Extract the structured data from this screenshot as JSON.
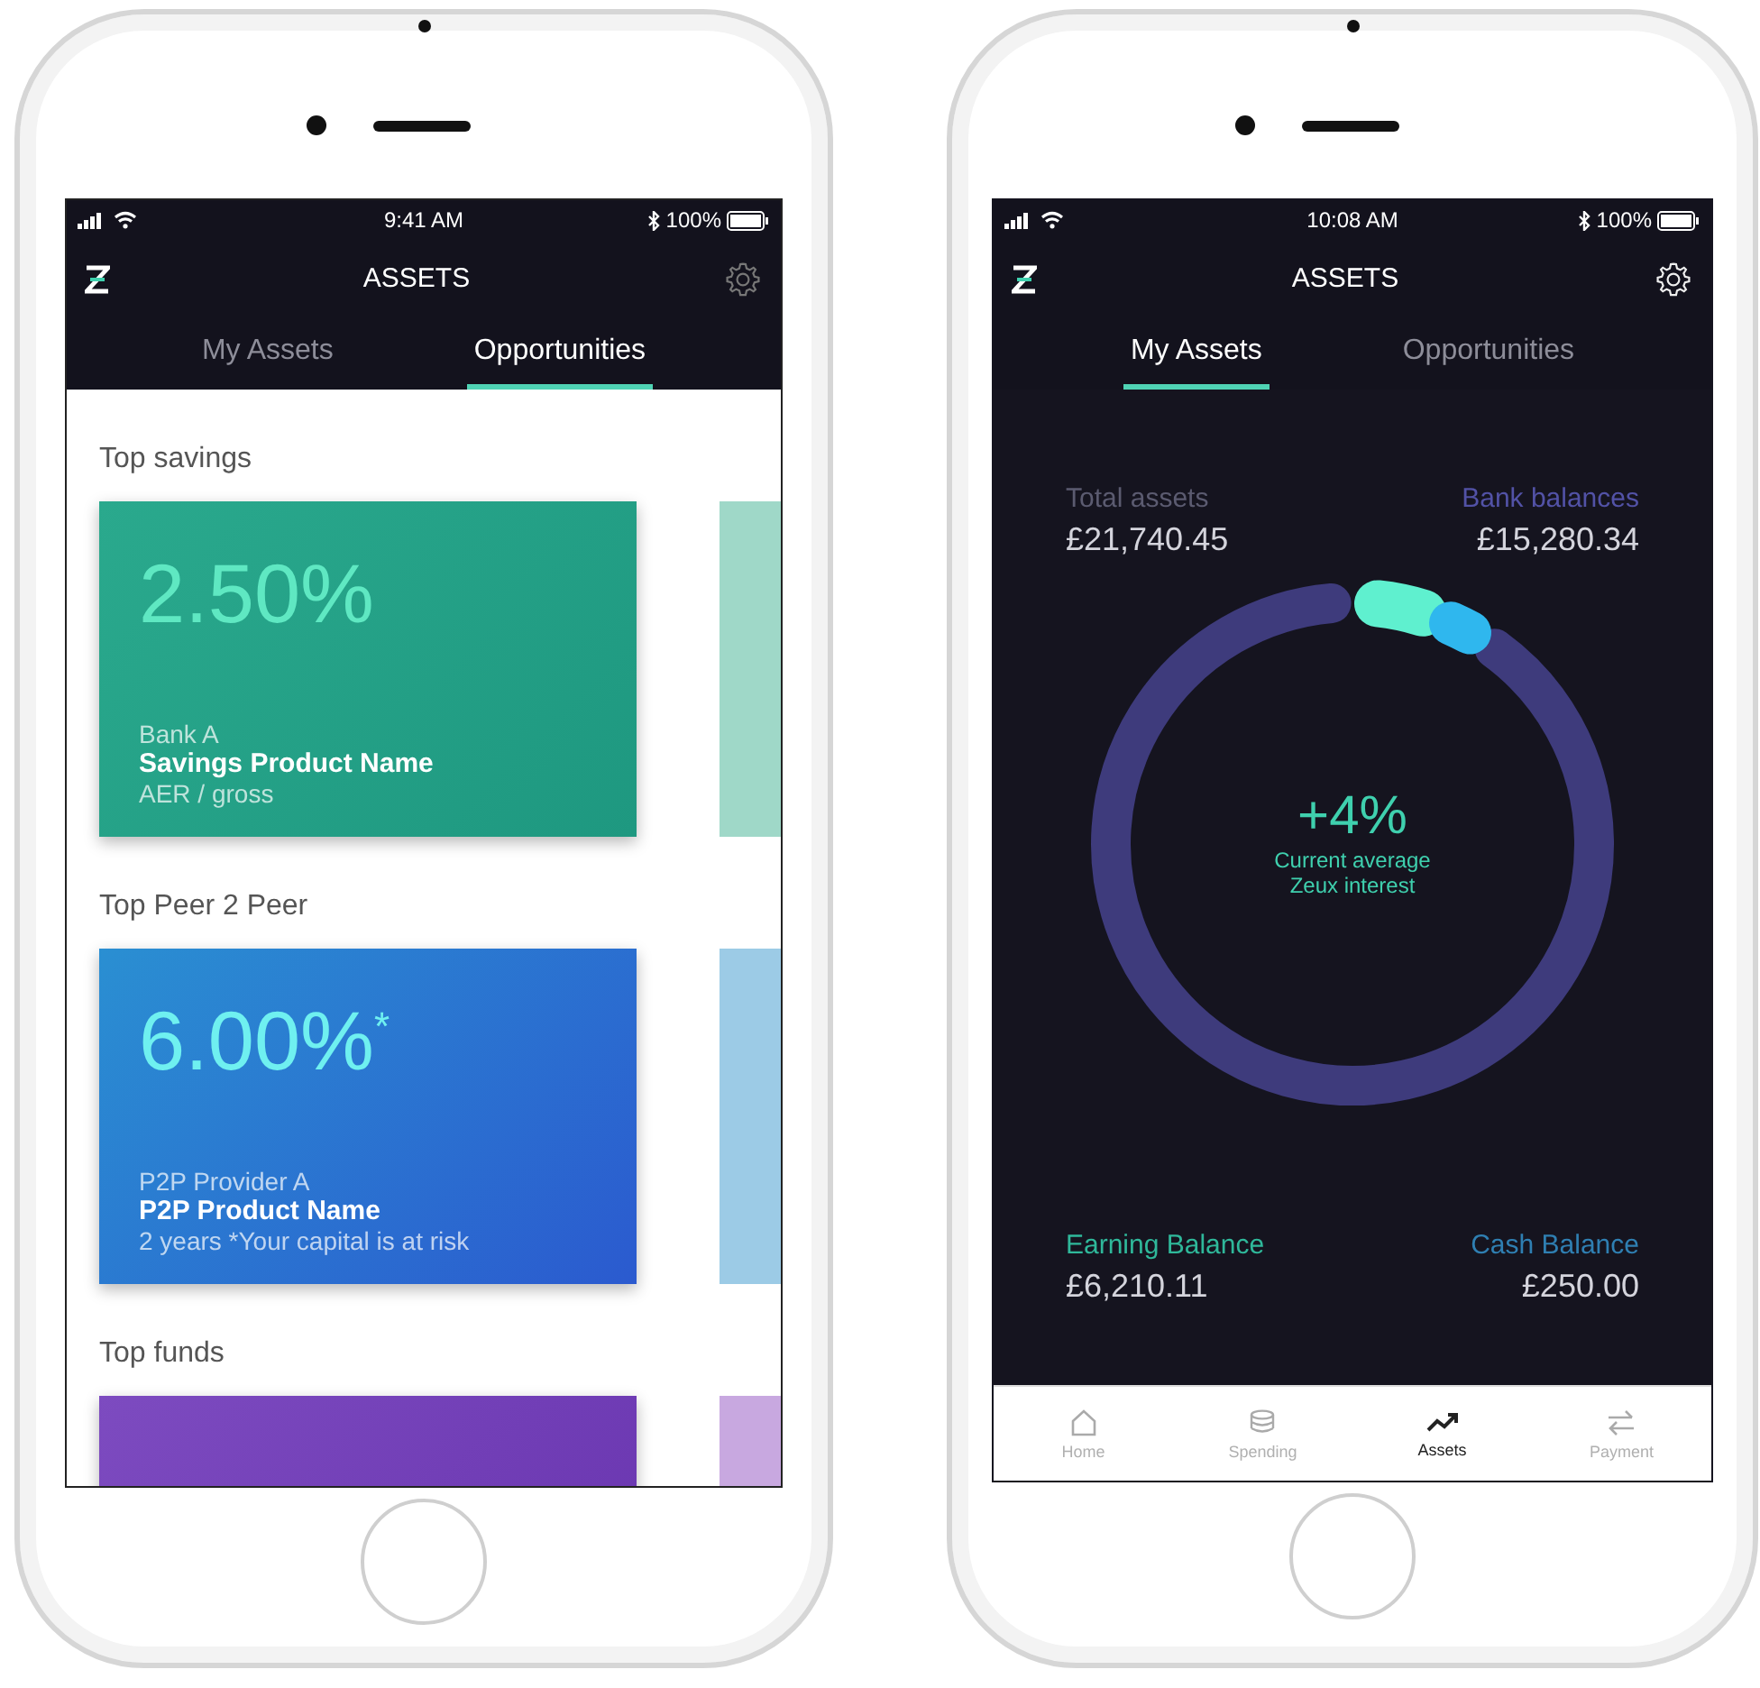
{
  "phones": [
    {
      "kind": "opportunities",
      "status_bar": {
        "time": "9:41 AM",
        "battery": "100%"
      },
      "title": "ASSETS",
      "tabs": [
        {
          "label": "My Assets",
          "selected": false
        },
        {
          "label": "Opportunities",
          "selected": true
        }
      ],
      "sections": [
        {
          "title": "Top savings",
          "kind": "savings",
          "cards": [
            {
              "kind": "full",
              "rate": "2.50%",
              "provider": "Bank A",
              "product": "Savings Product Name",
              "note": "AER / gross"
            },
            {
              "kind": "peek"
            }
          ]
        },
        {
          "title": "Top Peer 2 Peer",
          "kind": "p2p",
          "cards": [
            {
              "kind": "full",
              "rate": "6.00%$^{*}$",
              "provider": "P2P Provider A",
              "product": "P2P Product Name",
              "note": "2 years *Your capital is at risk"
            },
            {
              "kind": "peek"
            }
          ]
        },
        {
          "title": "Top funds",
          "kind": "funds",
          "cards": [
            {
              "kind": "full"
            },
            {
              "kind": "peek"
            }
          ]
        }
      ]
    },
    {
      "kind": "my_assets",
      "status_bar": {
        "time": "10:08 AM",
        "battery": "100%"
      },
      "title": "ASSETS",
      "tabs": [
        {
          "label": "My Assets",
          "selected": true
        },
        {
          "label": "Opportunities",
          "selected": false
        }
      ],
      "summary": [
        {
          "label": "Total assets",
          "value": "£21,740.45",
          "color": "#5b5b70"
        },
        {
          "label": "Bank balances",
          "value": "£15,280.34",
          "color": "#5252a6"
        }
      ],
      "interest": {
        "rate": "+4%",
        "caption": "Current average Zeux interest"
      },
      "balances": [
        {
          "label": "Earning Balance",
          "value": "£6,210.11",
          "color": "#2fb89a"
        },
        {
          "label": "Cash Balance",
          "value": "£250.00",
          "color": "#2f7fb2"
        }
      ],
      "bottom_nav": [
        {
          "label": "Home",
          "kind": "home",
          "selected": false
        },
        {
          "label": "Spending",
          "kind": "spending",
          "selected": false
        },
        {
          "label": "Assets",
          "kind": "assets",
          "selected": true
        },
        {
          "label": "Payment",
          "kind": "payment",
          "selected": false
        }
      ]
    }
  ]
}
